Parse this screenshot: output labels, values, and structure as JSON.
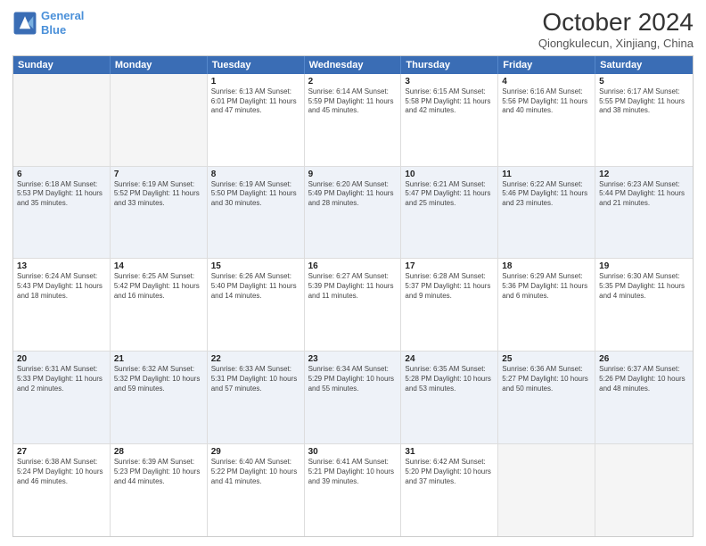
{
  "header": {
    "logo_line1": "General",
    "logo_line2": "Blue",
    "month_title": "October 2024",
    "location": "Qiongkulecun, Xinjiang, China"
  },
  "days_of_week": [
    "Sunday",
    "Monday",
    "Tuesday",
    "Wednesday",
    "Thursday",
    "Friday",
    "Saturday"
  ],
  "rows": [
    {
      "alt": false,
      "cells": [
        {
          "day": "",
          "info": ""
        },
        {
          "day": "",
          "info": ""
        },
        {
          "day": "1",
          "info": "Sunrise: 6:13 AM\nSunset: 6:01 PM\nDaylight: 11 hours and 47 minutes."
        },
        {
          "day": "2",
          "info": "Sunrise: 6:14 AM\nSunset: 5:59 PM\nDaylight: 11 hours and 45 minutes."
        },
        {
          "day": "3",
          "info": "Sunrise: 6:15 AM\nSunset: 5:58 PM\nDaylight: 11 hours and 42 minutes."
        },
        {
          "day": "4",
          "info": "Sunrise: 6:16 AM\nSunset: 5:56 PM\nDaylight: 11 hours and 40 minutes."
        },
        {
          "day": "5",
          "info": "Sunrise: 6:17 AM\nSunset: 5:55 PM\nDaylight: 11 hours and 38 minutes."
        }
      ]
    },
    {
      "alt": true,
      "cells": [
        {
          "day": "6",
          "info": "Sunrise: 6:18 AM\nSunset: 5:53 PM\nDaylight: 11 hours and 35 minutes."
        },
        {
          "day": "7",
          "info": "Sunrise: 6:19 AM\nSunset: 5:52 PM\nDaylight: 11 hours and 33 minutes."
        },
        {
          "day": "8",
          "info": "Sunrise: 6:19 AM\nSunset: 5:50 PM\nDaylight: 11 hours and 30 minutes."
        },
        {
          "day": "9",
          "info": "Sunrise: 6:20 AM\nSunset: 5:49 PM\nDaylight: 11 hours and 28 minutes."
        },
        {
          "day": "10",
          "info": "Sunrise: 6:21 AM\nSunset: 5:47 PM\nDaylight: 11 hours and 25 minutes."
        },
        {
          "day": "11",
          "info": "Sunrise: 6:22 AM\nSunset: 5:46 PM\nDaylight: 11 hours and 23 minutes."
        },
        {
          "day": "12",
          "info": "Sunrise: 6:23 AM\nSunset: 5:44 PM\nDaylight: 11 hours and 21 minutes."
        }
      ]
    },
    {
      "alt": false,
      "cells": [
        {
          "day": "13",
          "info": "Sunrise: 6:24 AM\nSunset: 5:43 PM\nDaylight: 11 hours and 18 minutes."
        },
        {
          "day": "14",
          "info": "Sunrise: 6:25 AM\nSunset: 5:42 PM\nDaylight: 11 hours and 16 minutes."
        },
        {
          "day": "15",
          "info": "Sunrise: 6:26 AM\nSunset: 5:40 PM\nDaylight: 11 hours and 14 minutes."
        },
        {
          "day": "16",
          "info": "Sunrise: 6:27 AM\nSunset: 5:39 PM\nDaylight: 11 hours and 11 minutes."
        },
        {
          "day": "17",
          "info": "Sunrise: 6:28 AM\nSunset: 5:37 PM\nDaylight: 11 hours and 9 minutes."
        },
        {
          "day": "18",
          "info": "Sunrise: 6:29 AM\nSunset: 5:36 PM\nDaylight: 11 hours and 6 minutes."
        },
        {
          "day": "19",
          "info": "Sunrise: 6:30 AM\nSunset: 5:35 PM\nDaylight: 11 hours and 4 minutes."
        }
      ]
    },
    {
      "alt": true,
      "cells": [
        {
          "day": "20",
          "info": "Sunrise: 6:31 AM\nSunset: 5:33 PM\nDaylight: 11 hours and 2 minutes."
        },
        {
          "day": "21",
          "info": "Sunrise: 6:32 AM\nSunset: 5:32 PM\nDaylight: 10 hours and 59 minutes."
        },
        {
          "day": "22",
          "info": "Sunrise: 6:33 AM\nSunset: 5:31 PM\nDaylight: 10 hours and 57 minutes."
        },
        {
          "day": "23",
          "info": "Sunrise: 6:34 AM\nSunset: 5:29 PM\nDaylight: 10 hours and 55 minutes."
        },
        {
          "day": "24",
          "info": "Sunrise: 6:35 AM\nSunset: 5:28 PM\nDaylight: 10 hours and 53 minutes."
        },
        {
          "day": "25",
          "info": "Sunrise: 6:36 AM\nSunset: 5:27 PM\nDaylight: 10 hours and 50 minutes."
        },
        {
          "day": "26",
          "info": "Sunrise: 6:37 AM\nSunset: 5:26 PM\nDaylight: 10 hours and 48 minutes."
        }
      ]
    },
    {
      "alt": false,
      "cells": [
        {
          "day": "27",
          "info": "Sunrise: 6:38 AM\nSunset: 5:24 PM\nDaylight: 10 hours and 46 minutes."
        },
        {
          "day": "28",
          "info": "Sunrise: 6:39 AM\nSunset: 5:23 PM\nDaylight: 10 hours and 44 minutes."
        },
        {
          "day": "29",
          "info": "Sunrise: 6:40 AM\nSunset: 5:22 PM\nDaylight: 10 hours and 41 minutes."
        },
        {
          "day": "30",
          "info": "Sunrise: 6:41 AM\nSunset: 5:21 PM\nDaylight: 10 hours and 39 minutes."
        },
        {
          "day": "31",
          "info": "Sunrise: 6:42 AM\nSunset: 5:20 PM\nDaylight: 10 hours and 37 minutes."
        },
        {
          "day": "",
          "info": ""
        },
        {
          "day": "",
          "info": ""
        }
      ]
    }
  ]
}
